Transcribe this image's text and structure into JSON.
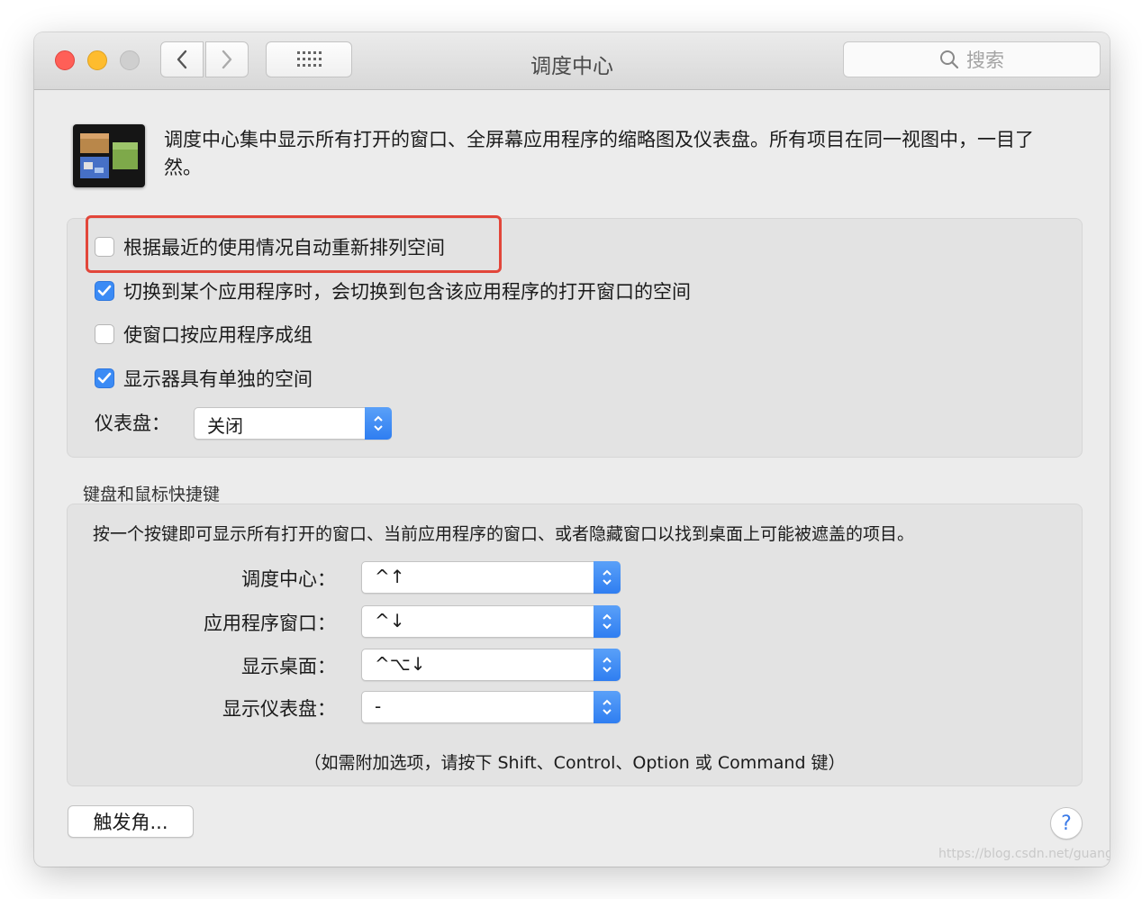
{
  "window": {
    "title": "调度中心"
  },
  "toolbar": {
    "search_placeholder": "搜索"
  },
  "description": "调度中心集中显示所有打开的窗口、全屏幕应用程序的缩略图及仪表盘。所有项目在同一视图中，一目了然。",
  "options": [
    {
      "label": "根据最近的使用情况自动重新排列空间",
      "checked": false
    },
    {
      "label": "切换到某个应用程序时，会切换到包含该应用程序的打开窗口的空间",
      "checked": true
    },
    {
      "label": "使窗口按应用程序成组",
      "checked": false
    },
    {
      "label": "显示器具有单独的空间",
      "checked": true
    }
  ],
  "dashboard": {
    "label": "仪表盘：",
    "value": "关闭"
  },
  "shortcuts": {
    "section_label": "键盘和鼠标快捷键",
    "description": "按一个按键即可显示所有打开的窗口、当前应用程序的窗口、或者隐藏窗口以找到桌面上可能被遮盖的项目。",
    "items": [
      {
        "label": "调度中心：",
        "value": "^↑"
      },
      {
        "label": "应用程序窗口：",
        "value": "^↓"
      },
      {
        "label": "显示桌面：",
        "value": "^⌥↓"
      },
      {
        "label": "显示仪表盘：",
        "value": "-"
      }
    ],
    "note": "（如需附加选项，请按下 Shift、Control、Option 或 Command 键）"
  },
  "hot_corners_button": "触发角...",
  "help_label": "?",
  "watermark": "https://blog.csdn.net/guang_s",
  "colors": {
    "accent": "#3b8bf5",
    "highlight": "#e2463a"
  }
}
